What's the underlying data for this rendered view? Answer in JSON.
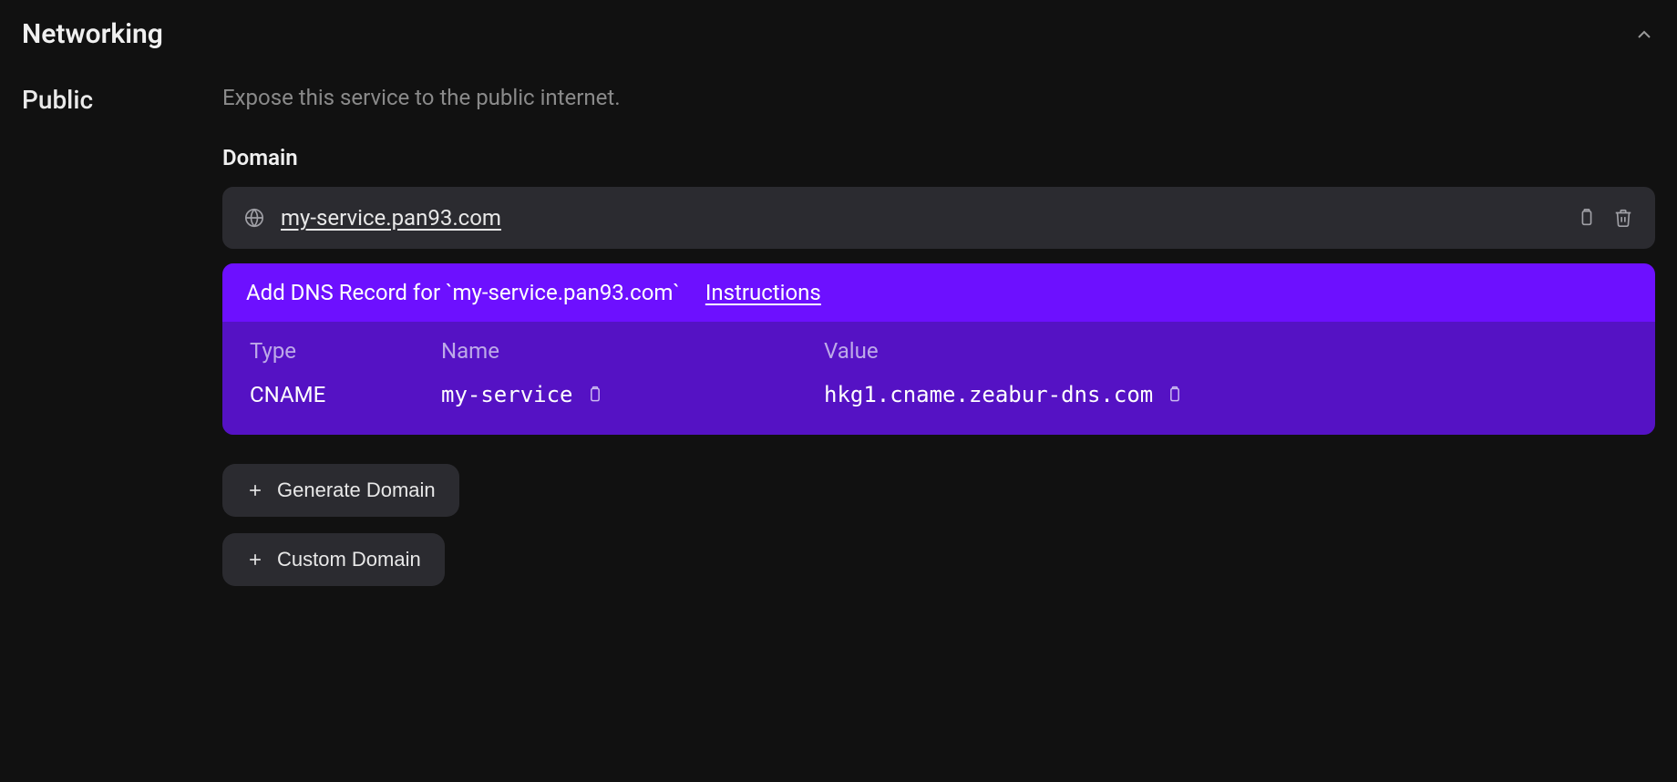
{
  "header": {
    "title": "Networking"
  },
  "public": {
    "label": "Public",
    "description": "Expose this service to the public internet.",
    "domain_label": "Domain",
    "domain_value": "my-service.pan93.com"
  },
  "dns": {
    "prompt_prefix": "Add DNS Record for ",
    "prompt_domain": "`my-service.pan93.com`",
    "instructions_label": "Instructions",
    "columns": {
      "type": "Type",
      "name": "Name",
      "value": "Value"
    },
    "record": {
      "type": "CNAME",
      "name": "my-service",
      "value": "hkg1.cname.zeabur-dns.com"
    }
  },
  "buttons": {
    "generate_domain": "Generate Domain",
    "custom_domain": "Custom Domain"
  }
}
